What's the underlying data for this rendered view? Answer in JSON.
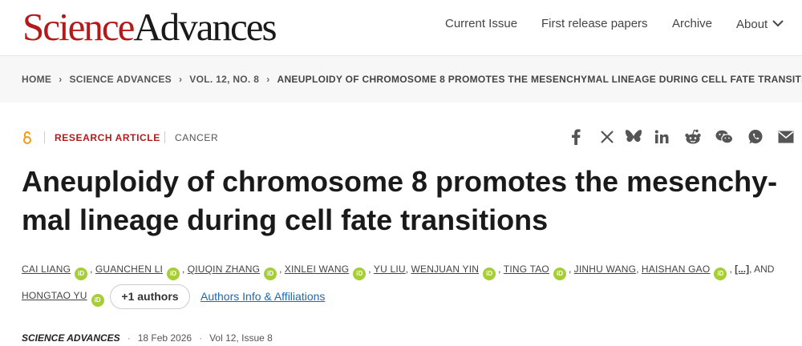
{
  "header": {
    "logo_science": "Science",
    "logo_advances": "Advances",
    "nav": [
      "Current Issue",
      "First release papers",
      "Archive",
      "About"
    ]
  },
  "breadcrumb": [
    "HOME",
    "SCIENCE ADVANCES",
    "VOL. 12, NO. 8",
    "ANEUPLOIDY OF CHROMOSOME 8 PROMOTES THE MESENCHYMAL LINEAGE DURING CELL FATE TRANSITIONS"
  ],
  "article": {
    "type": "RESEARCH ARTICLE",
    "subject": "CANCER",
    "title_line1": "Aneuploidy of chromosome 8 promotes the mesenchy-",
    "title_line2": "mal lineage during cell fate transitions",
    "authors": {
      "a1": "CAI LIANG",
      "a2": "GUANCHEN LI",
      "a3": "QIUQIN ZHANG",
      "a4": "XINLEI WANG",
      "a5": "YU LIU",
      "a6": "WENJUAN YIN",
      "a7": "TING TAO",
      "a8": "JINHU WANG",
      "a9": "HAISHAN GAO",
      "ellipsis": "[...]",
      "and": ", AND",
      "a10": "HONGTAO YU",
      "orcid_label": "iD"
    },
    "more_authors": "+1 authors",
    "affiliations_link": "Authors Info & Affiliations",
    "journal": "SCIENCE ADVANCES",
    "date": "18 Feb 2026",
    "volume": "Vol 12, Issue 8"
  },
  "share_icons": [
    "facebook-icon",
    "x-icon",
    "bluesky-icon",
    "linkedin-icon",
    "reddit-icon",
    "wechat-icon",
    "whatsapp-icon",
    "email-icon"
  ],
  "colors": {
    "brand_red": "#b31b1b",
    "orcid_green": "#a6ce39",
    "link_blue": "#1a6bb3",
    "oa_orange": "#f39c12"
  }
}
